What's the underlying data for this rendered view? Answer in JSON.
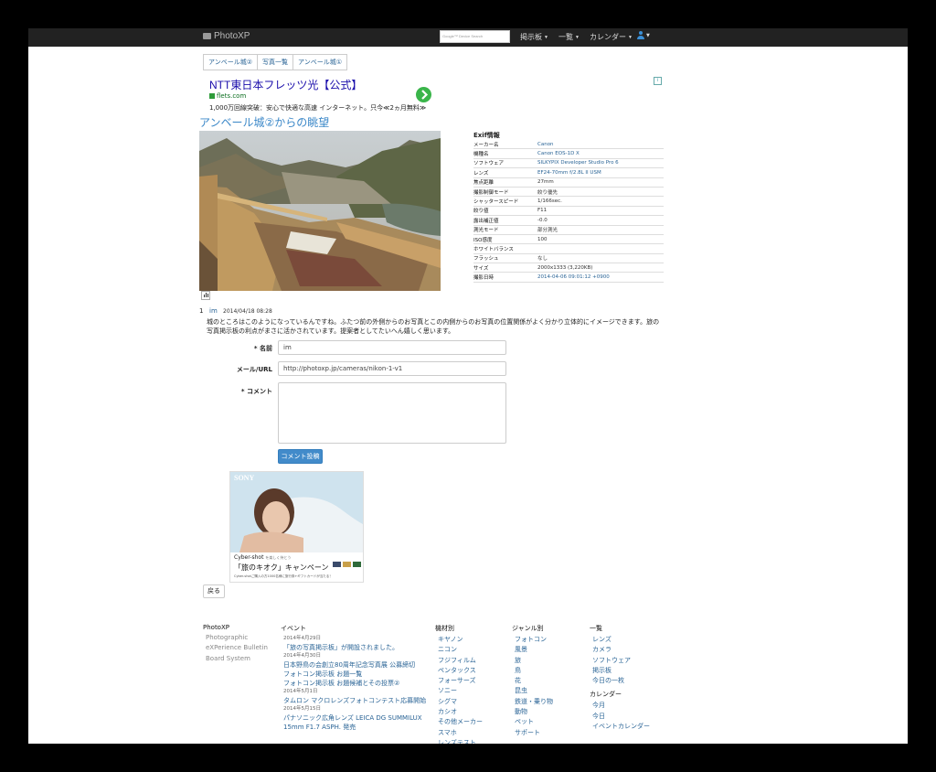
{
  "navbar": {
    "brand": "PhotoXP",
    "search_logo": "Google™",
    "search_placeholder": "Device Search",
    "menus": [
      "掲示板",
      "一覧",
      "カレンダー"
    ]
  },
  "breadcrumb": [
    "アンベール城②",
    "写真一覧",
    "アンベール城①"
  ],
  "ad": {
    "title": "NTT東日本フレッツ光【公式】",
    "url": "flets.com",
    "description": "1,000万回線突破：安心で快適な高速 インターネット。只今≪2ヵ月無料≫"
  },
  "photo": {
    "title": "アンベール城②からの眺望"
  },
  "exif": {
    "heading": "Exif情報",
    "rows": [
      {
        "key": "メーカー名",
        "value": "Canon"
      },
      {
        "key": "機種名",
        "value": "Canon EOS-1D X"
      },
      {
        "key": "ソフトウェア",
        "value": "SILKYPIX Developer Studio Pro 6"
      },
      {
        "key": "レンズ",
        "value": "EF24-70mm f/2.8L II USM"
      },
      {
        "key": "焦点距離",
        "value": "27mm"
      },
      {
        "key": "撮影制御モード",
        "value": "絞り優先"
      },
      {
        "key": "シャッタースピード",
        "value": "1/166sec."
      },
      {
        "key": "絞り値",
        "value": "F11"
      },
      {
        "key": "露出補正値",
        "value": "-0.0"
      },
      {
        "key": "測光モード",
        "value": "部分測光"
      },
      {
        "key": "ISO感度",
        "value": "100"
      },
      {
        "key": "ホワイトバランス",
        "value": ""
      },
      {
        "key": "フラッシュ",
        "value": "なし"
      },
      {
        "key": "サイズ",
        "value": "2000x1333 (3,220KB)"
      },
      {
        "key": "撮影日時",
        "value": "2014-04-06 09:01:12 +0900"
      }
    ]
  },
  "comment": {
    "number": "1",
    "author": "im",
    "date": "2014/04/18 08:28",
    "text": "城のところはこのようになっているんですね。ふたつ前の外側からのお写真とこの内側からのお写真の位置関係がよく分かり立体的にイメージできます。旅の写真掲示板の利点がまさに活かされています。提案者としてたいへん嬉しく思います。"
  },
  "form": {
    "name_label": "* 名前",
    "name_value": "im",
    "mail_label": "メール/URL",
    "mail_value": "http://photoxp.jp/cameras/nikon-1-v1",
    "comment_label": "* コメント",
    "submit_label": "コメント投稿"
  },
  "banner": {
    "brand": "SONY",
    "product": "Cyber-shot",
    "tagline": "を楽しく持とう",
    "campaign": "「旅のキオク」キャンペーン",
    "fine_print": "Cyber-shotご購入の方1000名様に旅行券+ギフトカードが当たる！"
  },
  "back_label": "戻る",
  "footer": {
    "about": {
      "heading": "PhotoXP",
      "items": [
        "Photographic",
        "eXPerience Bulletin",
        "Board System"
      ]
    },
    "events": {
      "heading": "イベント",
      "entries": [
        {
          "date": "2014年4月29日",
          "lines": [
            "「旅の写真掲示板」が開設されました。"
          ]
        },
        {
          "date": "2014年4月30日",
          "lines": [
            "日本野鳥の会創立80周年記念写真展 公募締切",
            "フォトコン掲示板 お題一覧",
            "フォトコン掲示板 お題候補とその投票②"
          ]
        },
        {
          "date": "2014年5月1日",
          "lines": [
            "タムロン マクロレンズフォトコンテスト応募開始"
          ]
        },
        {
          "date": "2014年5月15日",
          "lines": [
            "パナソニック広角レンズ LEICA DG SUMMILUX",
            "15mm F1.7 ASPH. 発売"
          ]
        }
      ]
    },
    "materials": {
      "heading": "機材別",
      "items": [
        "キヤノン",
        "ニコン",
        "フジフィルム",
        "ペンタックス",
        "フォーサーズ",
        "ソニー",
        "シグマ",
        "カシオ",
        "その他メーカー",
        "スマホ",
        "レンズテスト"
      ]
    },
    "genres": {
      "heading": "ジャンル別",
      "items": [
        "フォトコン",
        "風景",
        "旅",
        "鳥",
        "花",
        "昆虫",
        "鉄道・乗り物",
        "動物",
        "ペット",
        "サポート"
      ]
    },
    "lists": {
      "heading": "一覧",
      "items": [
        "レンズ",
        "カメラ",
        "ソフトウェア",
        "掲示板",
        "今日の一枚"
      ]
    },
    "calendar": {
      "heading": "カレンダー",
      "items": [
        "今月",
        "今日",
        "イベントカレンダー"
      ]
    }
  }
}
